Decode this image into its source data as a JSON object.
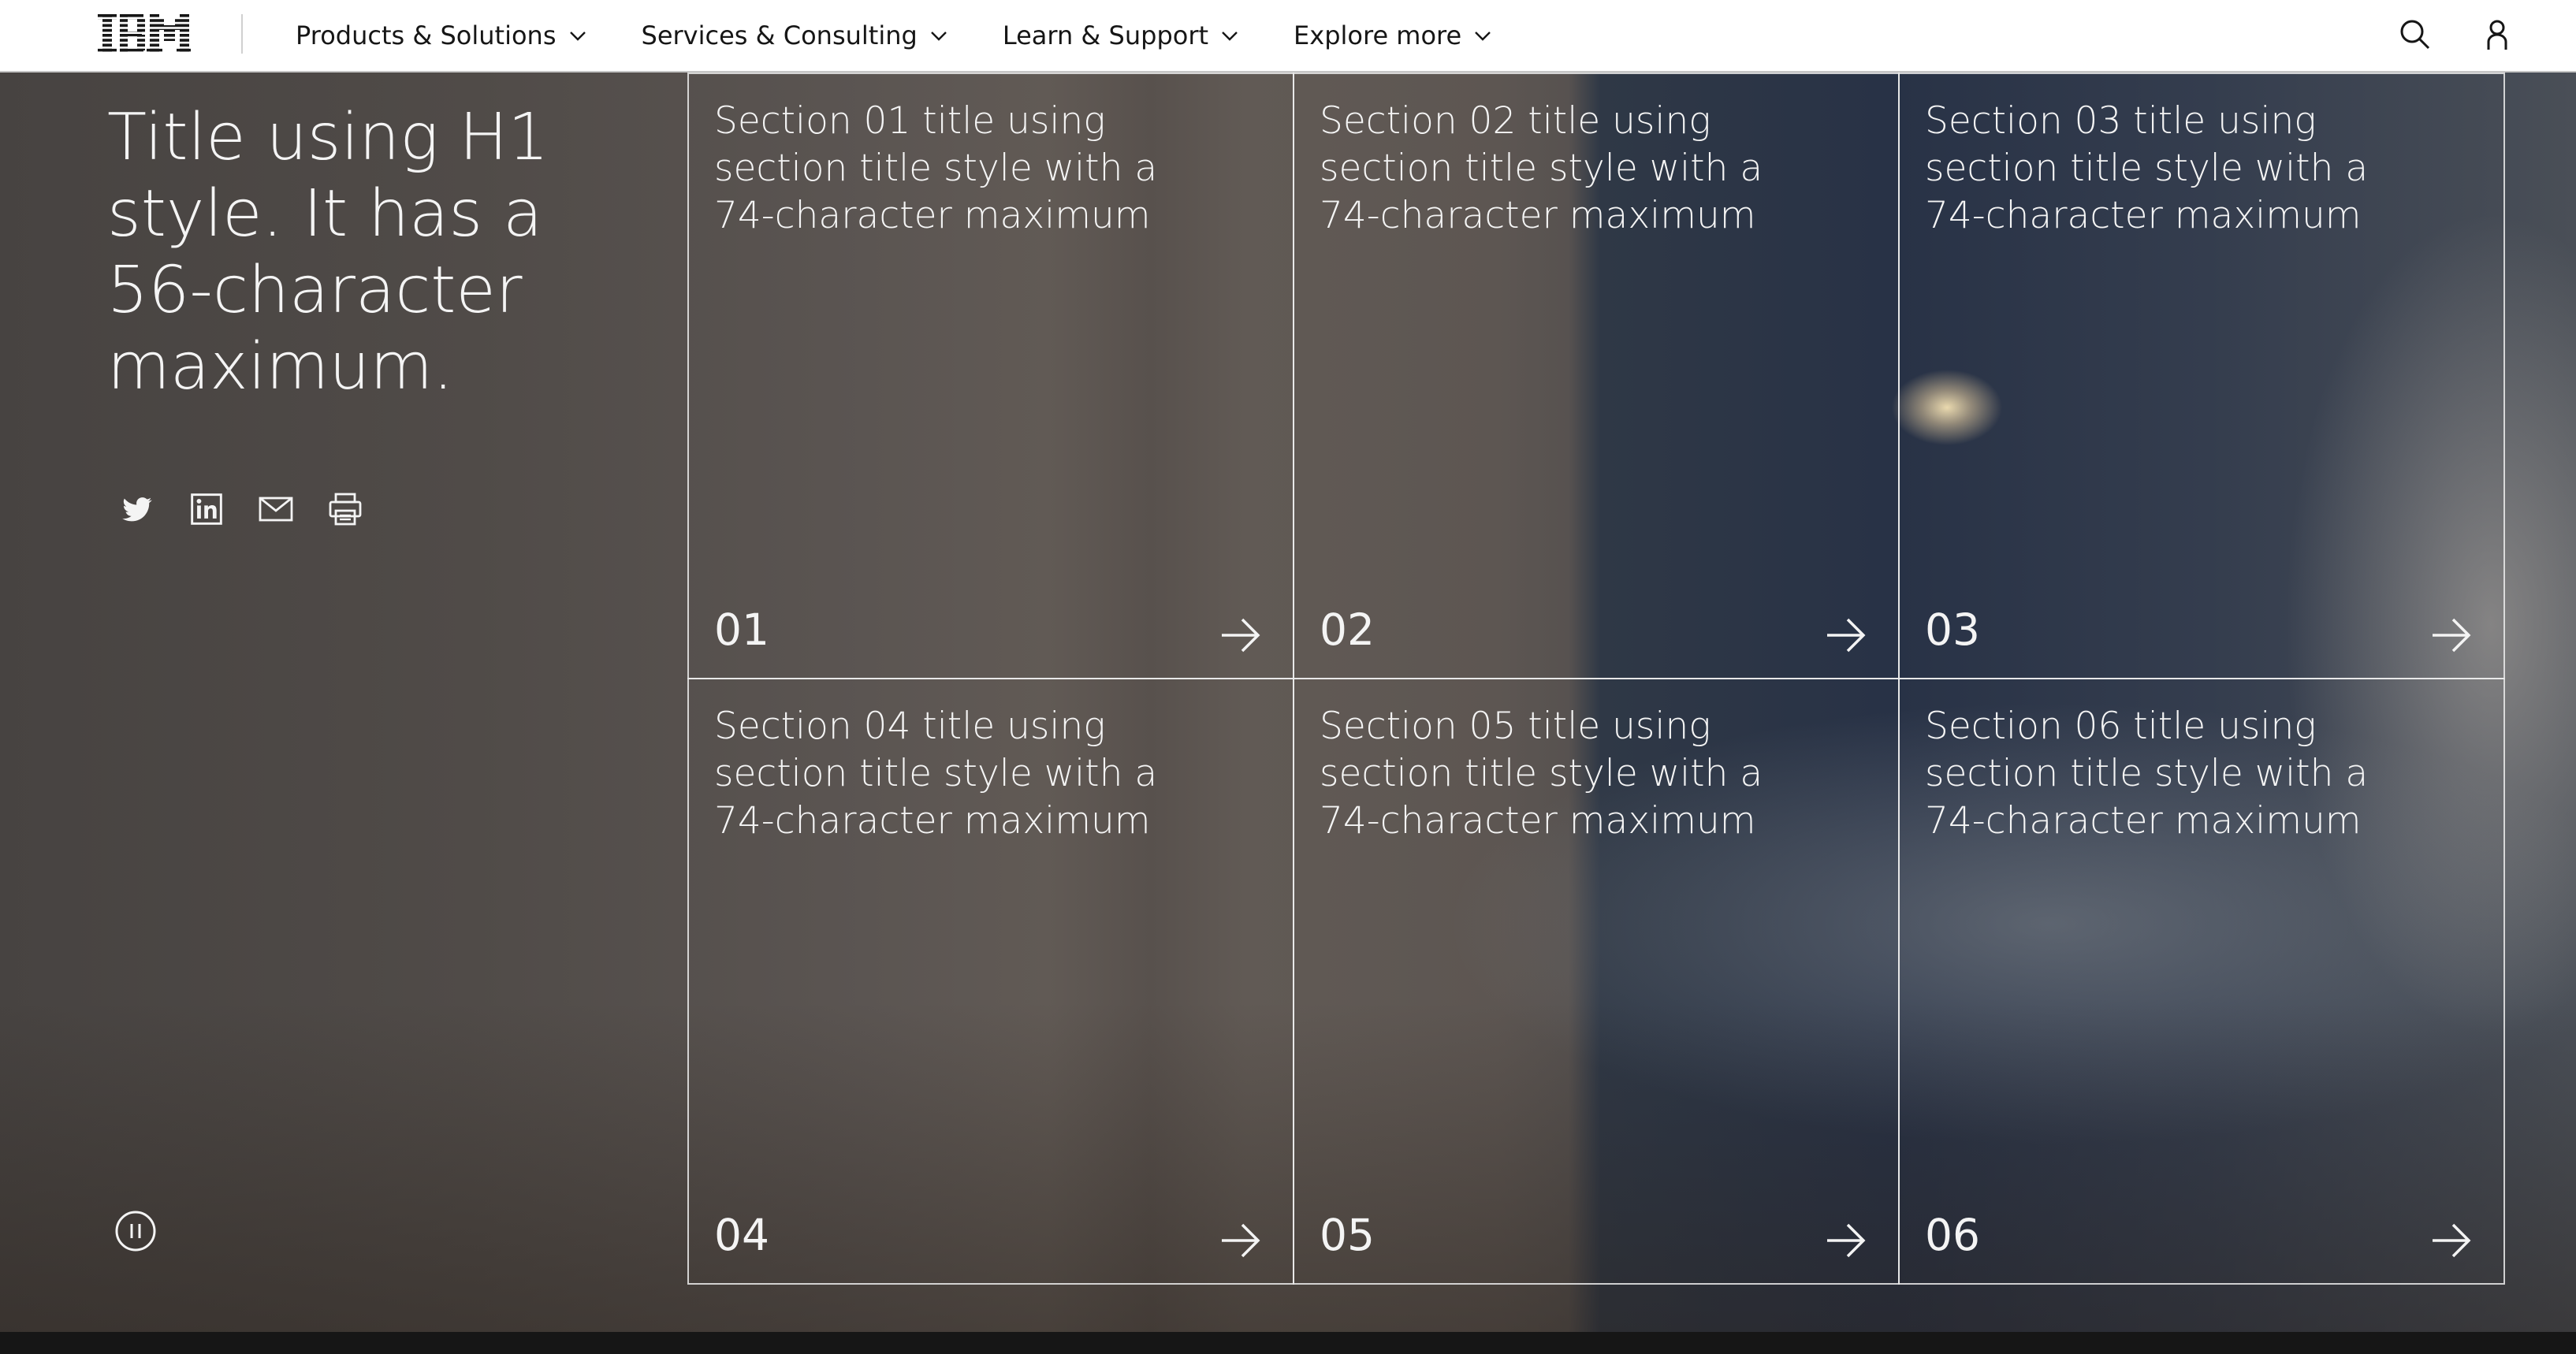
{
  "masthead": {
    "logo_icon": "ibm-logo",
    "nav": [
      {
        "label": "Products & Solutions"
      },
      {
        "label": "Services & Consulting"
      },
      {
        "label": "Learn & Support"
      },
      {
        "label": "Explore more"
      }
    ],
    "search_icon": "search-icon",
    "user_icon": "user-icon"
  },
  "hero": {
    "title": "Title using H1 style. It has a 56-character maximum.",
    "share_icons": [
      "twitter-icon",
      "linkedin-icon",
      "email-icon",
      "print-icon"
    ],
    "pause_icon": "pause-icon"
  },
  "cards": [
    {
      "title": "Section 01 title using section title style with a 74-character maximum",
      "number": "01"
    },
    {
      "title": "Section 02 title using section title style with a 74-character maximum",
      "number": "02"
    },
    {
      "title": "Section 03 title using section title style with a 74-character maximum",
      "number": "03"
    },
    {
      "title": "Section 04 title using section title style with a 74-character maximum",
      "number": "04"
    },
    {
      "title": "Section 05 title using section title style with a 74-character maximum",
      "number": "05"
    },
    {
      "title": "Section 06 title using section title style with a 74-character maximum",
      "number": "06"
    }
  ],
  "colors": {
    "masthead_bg": "#ffffff",
    "text_dark": "#161616",
    "text_light": "#f4f4f4",
    "card_border": "#ebebeb"
  }
}
